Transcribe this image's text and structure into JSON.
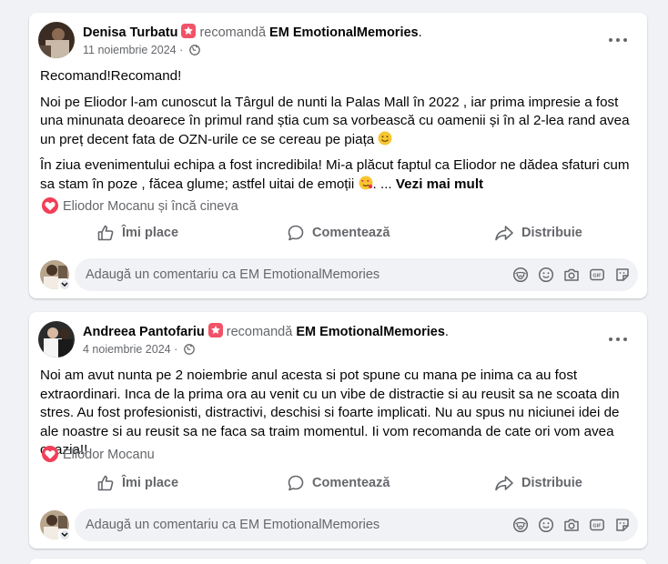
{
  "posts": [
    {
      "author": "Denisa Turbatu",
      "verb": "recomandă",
      "page": "EM EmotionalMemories",
      "dot": ".",
      "date": "11 noiembrie 2024",
      "date_sep": "·",
      "paragraphs": [
        "Recomand!Recomand!",
        "Noi pe Eliodor l-am cunoscut la Târgul de nunti la Palas Mall în 2022 , iar prima impresie a fost una minunata deoarece în primul rand știa cum sa vorbească cu oamenii și în al 2-lea rand avea un preț decent fata de OZN-urile ce se cereau pe piața",
        "În ziua evenimentului echipa a fost incredibila! Mi-a plăcut faptul ca Eliodor ne dădea sfaturi cum sa stam în poze , făcea glume; astfel uitai de emoții"
      ],
      "ellipsis": "...",
      "see_more": "Vezi mai mult",
      "reactions": "Eliodor Mocanu și încă cineva",
      "like_label": "Îmi place",
      "comment_label": "Comentează",
      "share_label": "Distribuie",
      "comment_placeholder": "Adaugă un comentariu ca EM EmotionalMemories"
    },
    {
      "author": "Andreea Pantofariu",
      "verb": "recomandă",
      "page": "EM EmotionalMemories",
      "dot": ".",
      "date": "4 noiembrie 2024",
      "date_sep": "·",
      "paragraphs": [
        "Noi am avut nunta pe 2 noiembrie anul acesta si pot spune cu mana pe inima ca au fost extraordinari. Inca de la prima ora au venit cu un vibe de distractie si au reusit sa ne scoata din stres. Au fost profesionisti, distractivi, deschisi si foarte implicati. Nu au spus nu niciunei idei de ale noastre si au reusit sa ne faca sa traim momentul. Ii vom recomanda de cate ori vom avea ocazia!!"
      ],
      "reactions": "Eliodor Mocanu",
      "like_label": "Îmi place",
      "comment_label": "Comentează",
      "share_label": "Distribuie",
      "comment_placeholder": "Adaugă un comentariu ca EM EmotionalMemories"
    }
  ],
  "colors": {
    "background": "#f0f2f5",
    "card": "#ffffff",
    "recommend_badge": "#f25268",
    "love_reaction": "#f33e58",
    "muted_text": "#65676b"
  },
  "icons": [
    "recommend-icon",
    "globe-icon",
    "more-options-icon",
    "smile-emoji-icon",
    "heart-eyes-emoji-icon",
    "love-reaction-icon",
    "like-icon",
    "comment-icon",
    "share-icon",
    "chevron-down-icon",
    "avatar-sticker-icon",
    "emoji-icon",
    "camera-icon",
    "gif-icon",
    "sticker-icon"
  ]
}
